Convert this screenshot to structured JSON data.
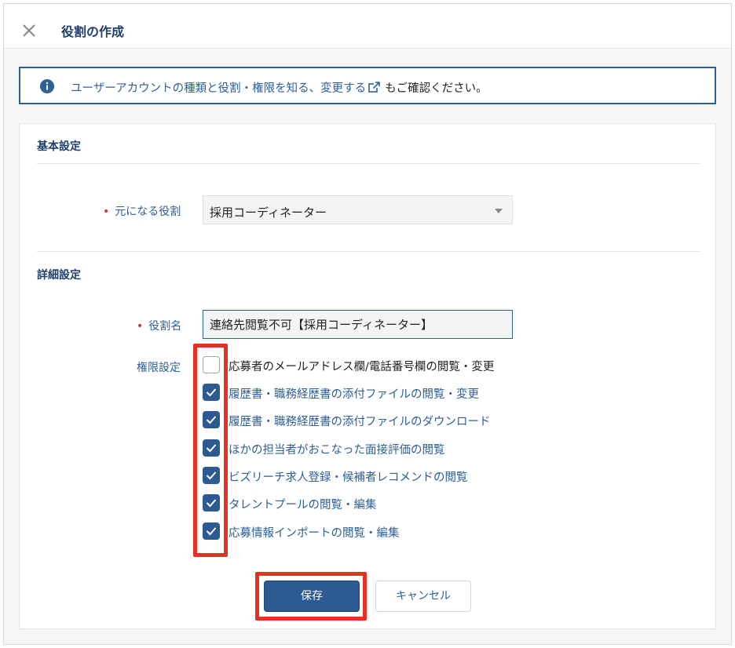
{
  "dialog": {
    "title": "役割の作成"
  },
  "notice": {
    "link_text": "ユーザーアカウントの種類と役割・権限を知る、変更する",
    "rest_text": "もご確認ください。"
  },
  "basic": {
    "section_title": "基本設定",
    "base_role_label": "元になる役割",
    "base_role_value": "採用コーディネーター"
  },
  "detail": {
    "section_title": "詳細設定",
    "role_name_label": "役割名",
    "role_name_value": "連絡先閲覧不可【採用コーディネーター】",
    "permissions_label": "権限設定",
    "permissions": [
      {
        "label": "応募者のメールアドレス欄/電話番号欄の閲覧・変更",
        "checked": false
      },
      {
        "label": "履歴書・職務経歴書の添付ファイルの閲覧・変更",
        "checked": true
      },
      {
        "label": "履歴書・職務経歴書の添付ファイルのダウンロード",
        "checked": true
      },
      {
        "label": "ほかの担当者がおこなった面接評価の閲覧",
        "checked": true
      },
      {
        "label": "ビズリーチ求人登録・候補者レコメンドの閲覧",
        "checked": true
      },
      {
        "label": "タレントプールの閲覧・編集",
        "checked": true
      },
      {
        "label": "応募情報インポートの閲覧・編集",
        "checked": true
      }
    ]
  },
  "actions": {
    "save_label": "保存",
    "cancel_label": "キャンセル"
  },
  "colors": {
    "accent": "#2c5a92",
    "link": "#2d5f98",
    "required_mark": "#c0392b",
    "highlight": "#e53224"
  },
  "icons": {
    "close": "close-icon",
    "info": "info-icon",
    "external_link": "external-link-icon",
    "dropdown": "chevron-down-icon",
    "check": "check-icon"
  }
}
